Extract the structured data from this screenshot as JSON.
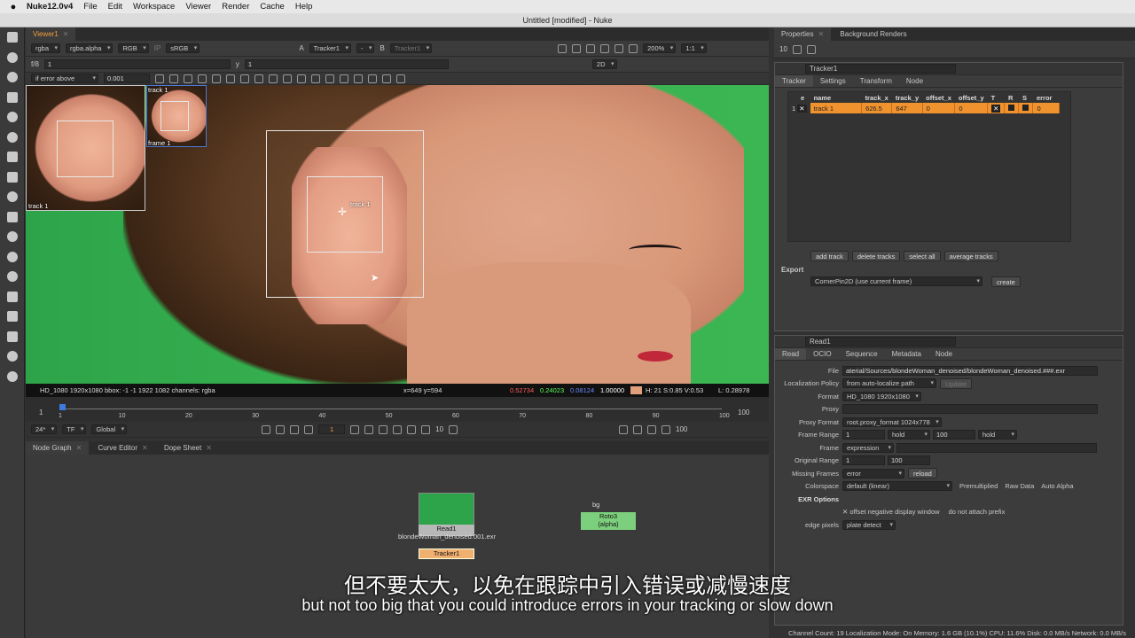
{
  "menubar": {
    "app": "Nuke12.0v4",
    "items": [
      "File",
      "Edit",
      "Workspace",
      "Viewer",
      "Render",
      "Cache",
      "Help"
    ]
  },
  "window_title": "Untitled [modified] - Nuke",
  "viewer": {
    "tab": "Viewer1",
    "bar1": {
      "channels": "rgba",
      "alpha": "rgba.alpha",
      "display": "RGB",
      "ip": "IP",
      "lut": "sRGB",
      "input_a": "Tracker1",
      "a_label": "A",
      "a_dash": "-",
      "b_label": "B",
      "input_b": "Tracker1",
      "zoom": "200%",
      "ratio": "1:1"
    },
    "bar2": {
      "fstop": "f/8",
      "gain": "1",
      "y_label": "y",
      "gamma": "1",
      "view_mode": "2D"
    },
    "bar3": {
      "error_mode": "if error above",
      "threshold": "0.001"
    },
    "overlay": {
      "thumb_track": "track 1",
      "thumb2_track": "track 1",
      "thumb2_frame": "frame 1",
      "box_track": "track 1"
    },
    "status": {
      "format": "HD_1080 1920x1080  bbox: -1 -1 1922 1082 channels: rgba",
      "coords": "x=649 y=594",
      "r": "0.52734",
      "g": "0.24023",
      "b": "0.08124",
      "a": "1.00000",
      "swatch_color": "#e2a07a",
      "hsv": "H: 21 S:0.85 V:0.53",
      "lum": "L: 0.28978"
    }
  },
  "timeline": {
    "ticks": [
      "1",
      "10",
      "20",
      "30",
      "40",
      "50",
      "60",
      "70",
      "80",
      "90",
      "100"
    ],
    "start": "1",
    "end": "100",
    "controls": {
      "fps": "24*",
      "tf": "TF",
      "scope": "Global",
      "frame": "1",
      "step": "10",
      "out": "100"
    }
  },
  "nodegraph": {
    "tabs": [
      "Node Graph",
      "Curve Editor",
      "Dope Sheet"
    ],
    "read_node": {
      "label": "Read1",
      "file": "blondeWoman_denoised.001.exr"
    },
    "tracker_node": {
      "label": "Tracker1"
    },
    "roto_node": {
      "label": "Roto3",
      "sub": "(alpha)"
    },
    "bg_label": "bg"
  },
  "properties": {
    "tabs": [
      "Properties",
      "Background Renders"
    ],
    "max_panels": "10",
    "tracker_panel": {
      "title": "Tracker1",
      "tabs": [
        "Tracker",
        "Settings",
        "Transform",
        "Node"
      ],
      "columns": [
        "e",
        "name",
        "track_x",
        "track_y",
        "offset_x",
        "offset_y",
        "T",
        "R",
        "S",
        "error"
      ],
      "rows": [
        {
          "index": "1",
          "name": "track 1",
          "track_x": "626.5",
          "track_y": "647",
          "offset_x": "0",
          "offset_y": "0",
          "error": "0"
        }
      ],
      "buttons": [
        "add track",
        "delete tracks",
        "select all",
        "average tracks"
      ],
      "export_label": "Export",
      "export_value": "CornerPin2D (use current frame)",
      "create": "create"
    },
    "read_panel": {
      "title": "Read1",
      "tabs": [
        "Read",
        "OCIO",
        "Sequence",
        "Metadata",
        "Node"
      ],
      "file_label": "File",
      "file": "aterial/Sources/blondeWoman_denoised/blondeWoman_denoised.###.exr",
      "localization_label": "Localization Policy",
      "localization": "from auto-localize path",
      "update": "Update",
      "format_label": "Format",
      "format": "HD_1080 1920x1080",
      "proxy_label": "Proxy",
      "proxy_format_label": "Proxy Format",
      "proxy_format": "root.proxy_format 1024x778",
      "frame_range_label": "Frame Range",
      "frame_start": "1",
      "hold1": "hold",
      "frame_end": "100",
      "hold2": "hold",
      "frame_label": "Frame",
      "frame": "expression",
      "orig_range_label": "Original Range",
      "orig_start": "1",
      "orig_end": "100",
      "missing_label": "Missing Frames",
      "missing": "error",
      "reload": "reload",
      "colorspace_label": "Colorspace",
      "colorspace": "default (linear)",
      "premult": "Premultiplied",
      "raw": "Raw Data",
      "auto_alpha": "Auto Alpha",
      "exr_label": "EXR Options",
      "offset_neg": "offset negative display window",
      "no_prefix": "do not attach prefix",
      "edge_label": "edge pixels",
      "edge": "plate detect"
    }
  },
  "subtitles": {
    "cn": "但不要太大，以免在跟踪中引入错误或减慢速度",
    "en": "but not too big that you could introduce errors in your tracking or slow down"
  },
  "statusbar": "Channel Count: 19  Localization Mode: On  Memory: 1.6 GB (10.1%)  CPU: 11.6%  Disk: 0.0 MB/s  Network: 0.0 MB/s"
}
